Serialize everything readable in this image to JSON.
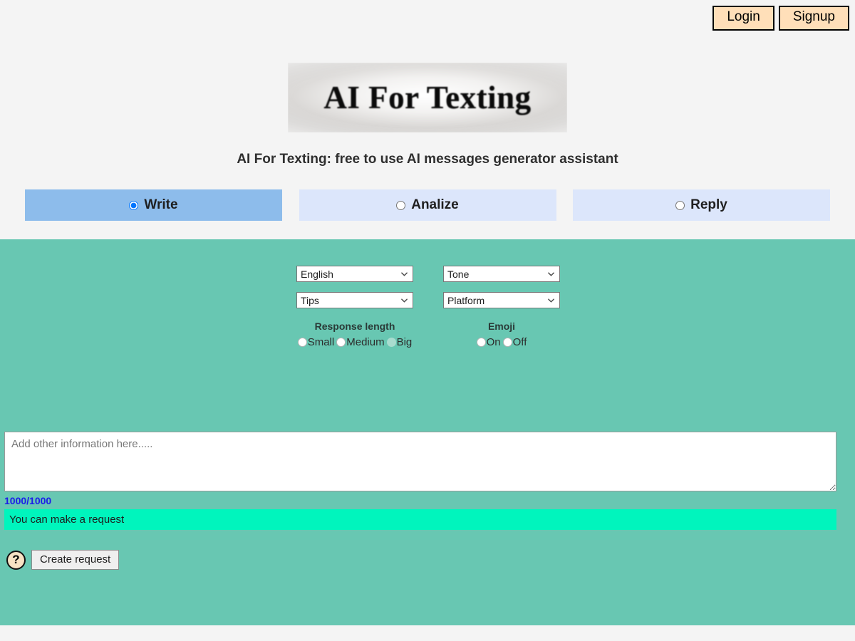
{
  "auth": {
    "login_label": "Login",
    "signup_label": "Signup"
  },
  "branding": {
    "logo_text": "AI For Texting",
    "subtitle": "AI For Texting: free to use AI messages generator assistant"
  },
  "tabs": [
    {
      "label": "Write",
      "selected": true
    },
    {
      "label": "Analize",
      "selected": false
    },
    {
      "label": "Reply",
      "selected": false
    }
  ],
  "form": {
    "selects": [
      {
        "name": "language",
        "value": "English"
      },
      {
        "name": "tone",
        "value": "Tone"
      },
      {
        "name": "tips",
        "value": "Tips"
      },
      {
        "name": "platform",
        "value": "Platform"
      }
    ],
    "response_length": {
      "title": "Response length",
      "options": [
        "Small",
        "Medium",
        "Big"
      ]
    },
    "emoji": {
      "title": "Emoji",
      "options": [
        "On",
        "Off"
      ]
    },
    "textarea_placeholder": "Add other information here.....",
    "textarea_value": "",
    "char_counter": "1000/1000",
    "status_message": "You can make a request",
    "help_glyph": "?",
    "create_button_label": "Create request"
  },
  "colors": {
    "panel_teal": "#68c7b2",
    "status_green": "#00f5bd",
    "tab_active": "#8dbceb",
    "tab_inactive": "#dce6fb",
    "auth_button": "#ffdfb9",
    "counter_blue": "#1b1bea"
  }
}
